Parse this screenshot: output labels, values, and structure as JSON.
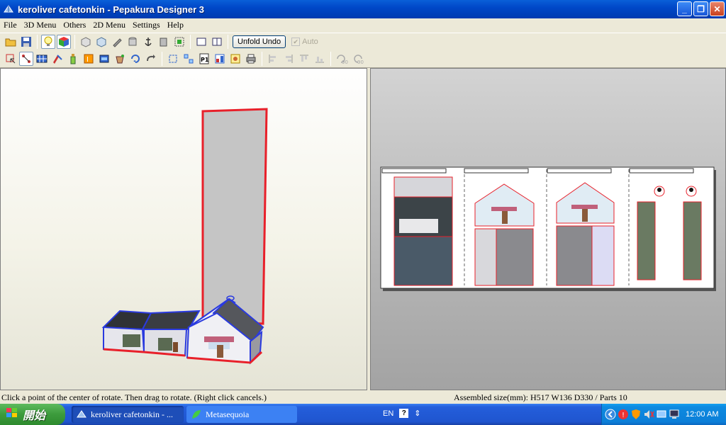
{
  "window": {
    "title": "keroliver cafetonkin - Pepakura Designer 3",
    "buttons": {
      "minimize": "_",
      "maximize": "❐",
      "close": "✕"
    }
  },
  "menu": [
    "File",
    "3D Menu",
    "Others",
    "2D Menu",
    "Settings",
    "Help"
  ],
  "toolbar": {
    "unfold_undo": "Unfold Undo",
    "auto_label": "Auto",
    "auto_checked": true,
    "rotate_90": "90",
    "rotate_neg90": "90"
  },
  "status": {
    "left": "Click a point of the center of rotate. Then drag to rotate. (Right click cancels.)",
    "right": "Assembled size(mm): H517 W136 D330 / Parts 10"
  },
  "taskbar": {
    "start_label": "開始",
    "tasks": [
      "keroliver cafetonkin - ...",
      "Metasequoia"
    ],
    "lang": "EN",
    "help_glyph": "?",
    "clock": "12:00 AM"
  },
  "colors": {
    "edge_red": "#e8202a",
    "edge_blue": "#2a3adf",
    "title_blue": "#0a5fd8"
  }
}
